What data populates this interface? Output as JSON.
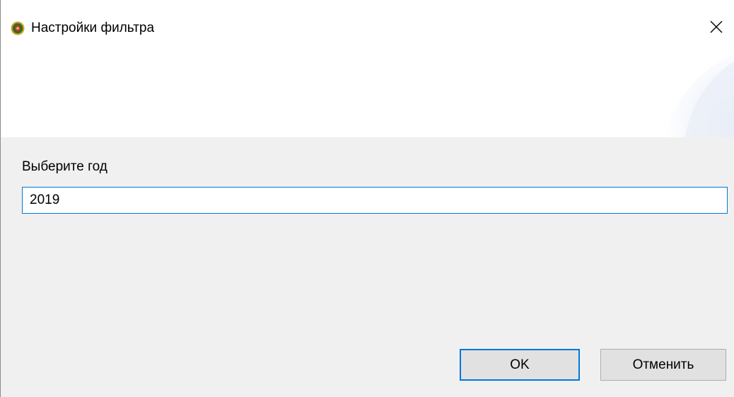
{
  "window": {
    "title": "Настройки фильтра",
    "accent_color": "#0078d7"
  },
  "icons": {
    "app": "app-emblem-icon",
    "close": "close-icon"
  },
  "form": {
    "year_label": "Выберите год",
    "year_value": "2019"
  },
  "buttons": {
    "ok_label": "OK",
    "cancel_label": "Отменить"
  }
}
